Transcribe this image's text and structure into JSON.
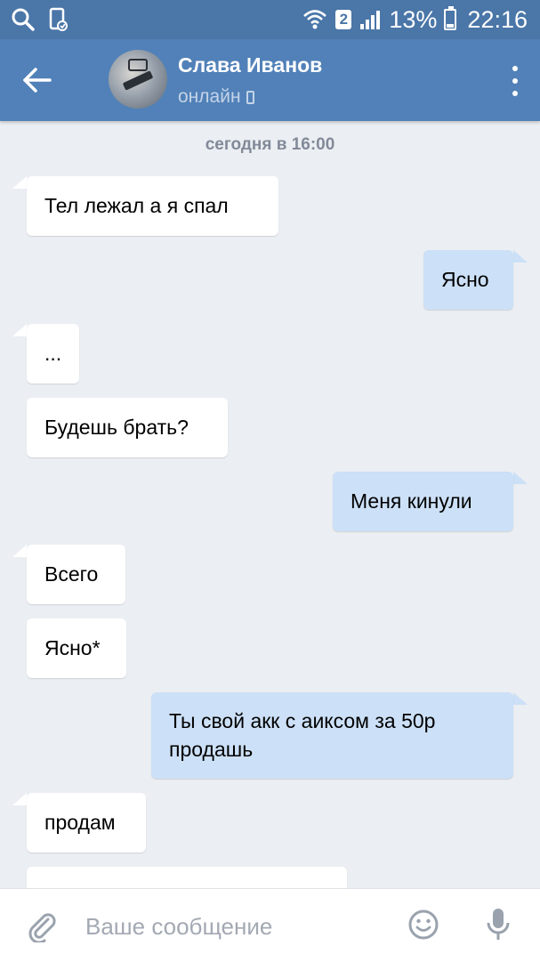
{
  "status_bar": {
    "sim_slot": "2",
    "battery": "13%",
    "time": "22:16"
  },
  "header": {
    "contact_name": "Слава Иванов",
    "status": "онлайн"
  },
  "conversation": {
    "date_separator": "сегодня в 16:00",
    "messages": [
      {
        "direction": "in",
        "text": "Тел лежал а я спал"
      },
      {
        "direction": "out",
        "text": "Ясно"
      },
      {
        "direction": "in",
        "text": "..."
      },
      {
        "direction": "in",
        "text": "Будешь брать?"
      },
      {
        "direction": "out",
        "text": "Меня кинули"
      },
      {
        "direction": "in",
        "text": "Всего"
      },
      {
        "direction": "in",
        "text": "Ясно*"
      },
      {
        "direction": "out",
        "text": "Ты свой акк с аиксом за 50р продашь"
      },
      {
        "direction": "in",
        "text": "продам"
      }
    ]
  },
  "composer": {
    "placeholder": "Ваше сообщение"
  },
  "colors": {
    "header": "#5181b8",
    "status_bar": "#4a76a8",
    "background": "#ebeef2",
    "incoming_bubble": "#ffffff",
    "outgoing_bubble": "#cce0f7"
  }
}
